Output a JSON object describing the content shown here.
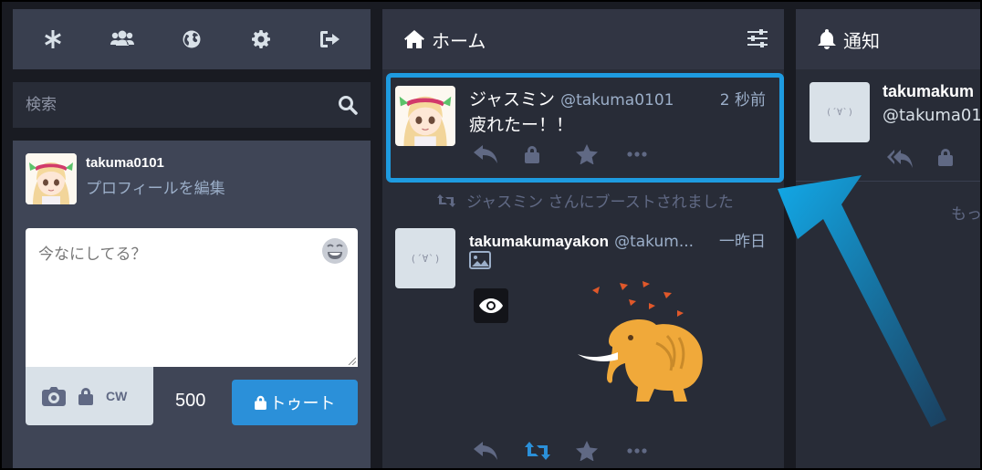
{
  "drawer": {
    "nav": [
      {
        "id": "getting-started",
        "icon": "asterisk-icon"
      },
      {
        "id": "local-timeline",
        "icon": "users-icon"
      },
      {
        "id": "federated-timeline",
        "icon": "globe-icon"
      },
      {
        "id": "preferences",
        "icon": "gear-icon"
      },
      {
        "id": "logout",
        "icon": "sign-out-icon"
      }
    ],
    "search_placeholder": "検索",
    "account": {
      "username": "takuma0101",
      "edit_profile": "プロフィールを編集"
    },
    "compose": {
      "placeholder": "今なにしてる？",
      "cw_label": "CW",
      "char_count": "500",
      "toot_label": "トゥート"
    }
  },
  "home_column": {
    "title": "ホーム",
    "statuses": [
      {
        "display_name": "ジャスミン",
        "acct": "@takuma0101",
        "time": "2 秒前",
        "content": "疲れたー！！"
      },
      {
        "boost_notice": "ジャスミン さんにブーストされました",
        "display_name": "takumakumayakon",
        "acct": "@takum...",
        "time": "一昨日",
        "placeholder_face": "(´∀`)"
      }
    ]
  },
  "notifications_column": {
    "title": "通知",
    "item": {
      "display_name": "takumakum",
      "acct": "@takuma01",
      "placeholder_face": "(´∀`)"
    },
    "load_more": "もっ"
  },
  "colors": {
    "accent": "#2b90d9",
    "highlight": "#1e9be0",
    "column_bg": "#282c37",
    "drawer_bg": "#3f4556"
  }
}
